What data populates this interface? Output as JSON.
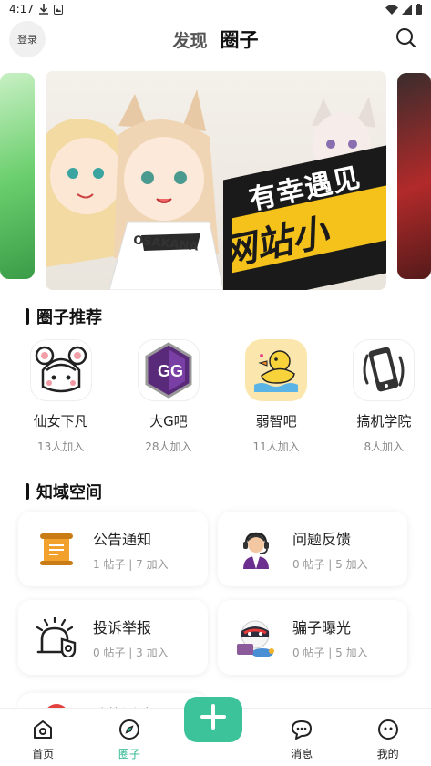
{
  "status_bar": {
    "time": "4:17"
  },
  "header": {
    "login_label": "登录",
    "tabs": [
      {
        "label": "发现"
      },
      {
        "label": "圈子"
      }
    ],
    "search_icon": "search-icon"
  },
  "banner": {
    "line1": "有幸遇见",
    "line2": "网站小",
    "brand": "OSAKANA"
  },
  "recommend": {
    "title": "圈子推荐",
    "items": [
      {
        "name": "仙女下凡",
        "count": "13人加入"
      },
      {
        "name": "大G吧",
        "count": "28人加入"
      },
      {
        "name": "弱智吧",
        "count": "11人加入"
      },
      {
        "name": "搞机学院",
        "count": "8人加入"
      }
    ]
  },
  "spaces": {
    "title": "知域空间",
    "items": [
      {
        "name": "公告通知",
        "meta": "1 帖子 | 7 加入",
        "icon": "scroll-icon"
      },
      {
        "name": "问题反馈",
        "meta": "0 帖子 | 5 加入",
        "icon": "support-agent-icon"
      },
      {
        "name": "投诉举报",
        "meta": "0 帖子 | 3 加入",
        "icon": "report-icon"
      },
      {
        "name": "骗子曝光",
        "meta": "0 帖子 | 5 加入",
        "icon": "bandit-icon"
      }
    ],
    "partial": {
      "name": "功能测试"
    }
  },
  "bottom_nav": [
    {
      "label": "首页",
      "icon": "home-icon"
    },
    {
      "label": "圈子",
      "icon": "compass-icon"
    },
    {
      "label": "",
      "icon": "plus-icon"
    },
    {
      "label": "消息",
      "icon": "chat-icon"
    },
    {
      "label": "我的",
      "icon": "profile-icon"
    }
  ],
  "colors": {
    "accent": "#3cc39a",
    "active_tab": "#2bb68f"
  }
}
